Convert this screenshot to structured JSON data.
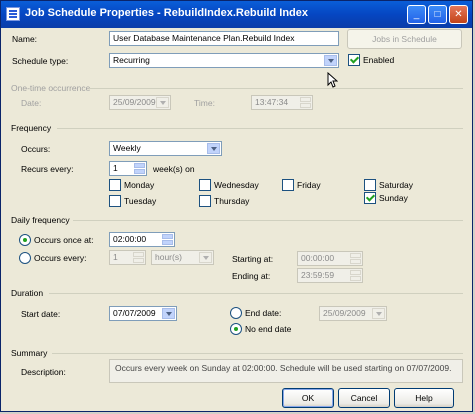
{
  "window": {
    "title": "Job Schedule Properties - RebuildIndex.Rebuild Index"
  },
  "name": {
    "label": "Name:",
    "value": "User Database Maintenance Plan.Rebuild Index",
    "jobs_button": "Jobs in Schedule"
  },
  "schedule_type": {
    "label": "Schedule type:",
    "value": "Recurring",
    "enabled_label": "Enabled",
    "enabled_checked": true
  },
  "one_time": {
    "header": "One-time occurrence",
    "date_label": "Date:",
    "date_value": "25/09/2009",
    "time_label": "Time:",
    "time_value": "13:47:34"
  },
  "frequency": {
    "header": "Frequency",
    "occurs_label": "Occurs:",
    "occurs_value": "Weekly",
    "recurs_label": "Recurs every:",
    "recurs_value": "1",
    "recurs_unit": "week(s) on",
    "days": [
      {
        "label": "Monday",
        "checked": false
      },
      {
        "label": "Wednesday",
        "checked": false
      },
      {
        "label": "Friday",
        "checked": false
      },
      {
        "label": "Saturday",
        "checked": false
      },
      {
        "label": "Tuesday",
        "checked": false
      },
      {
        "label": "Thursday",
        "checked": false
      },
      {
        "label": "Sunday",
        "checked": true
      }
    ]
  },
  "daily": {
    "header": "Daily frequency",
    "once_label": "Occurs once at:",
    "once_value": "02:00:00",
    "once_selected": true,
    "every_label": "Occurs every:",
    "every_value": "1",
    "every_unit": "hour(s)",
    "starting_label": "Starting at:",
    "starting_value": "00:00:00",
    "ending_label": "Ending at:",
    "ending_value": "23:59:59"
  },
  "duration": {
    "header": "Duration",
    "start_label": "Start date:",
    "start_value": "07/07/2009",
    "end_label": "End date:",
    "end_value": "25/09/2009",
    "no_end_label": "No end date",
    "no_end_selected": true
  },
  "summary": {
    "header": "Summary",
    "desc_label": "Description:",
    "desc_value": "Occurs every week on Sunday at 02:00:00. Schedule will be used starting on 07/07/2009."
  },
  "buttons": {
    "ok": "OK",
    "cancel": "Cancel",
    "help": "Help"
  },
  "colors": {
    "titlebar": "#0a5ed8",
    "dialog_bg": "#ece9d8",
    "check_green": "#21a121"
  }
}
